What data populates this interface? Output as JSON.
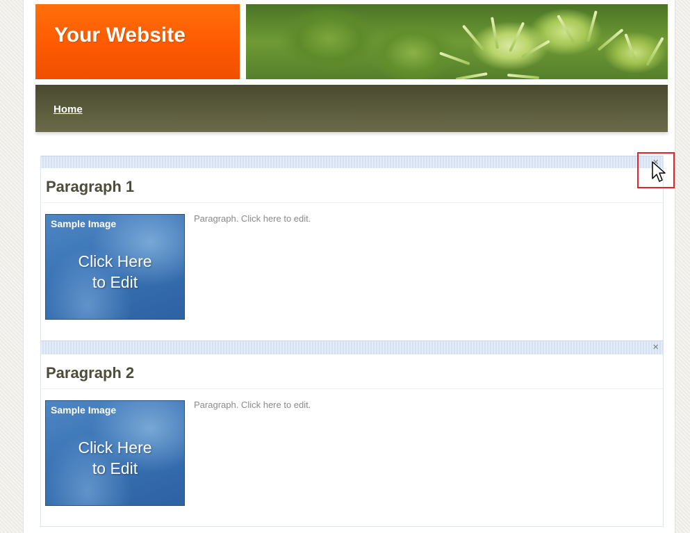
{
  "header": {
    "logo_text": "Your Website"
  },
  "nav": {
    "items": [
      {
        "label": "Home"
      }
    ]
  },
  "sections": [
    {
      "title": "Paragraph 1",
      "image_caption": "Sample Image",
      "image_text_line1": "Click Here",
      "image_text_line2": "to Edit",
      "paragraph": "Paragraph. Click here to edit.",
      "close_symbol": "×"
    },
    {
      "title": "Paragraph 2",
      "image_caption": "Sample Image",
      "image_text_line1": "Click Here",
      "image_text_line2": "to Edit",
      "paragraph": "Paragraph. Click here to edit.",
      "close_symbol": "×"
    }
  ],
  "colors": {
    "logo_orange": "#fd5a02",
    "nav_olive": "#5a5a3c",
    "highlight_red": "#e2232a",
    "image_blue": "#3a73b5"
  },
  "icons": [
    "close-icon",
    "mouse-pointer-icon"
  ]
}
